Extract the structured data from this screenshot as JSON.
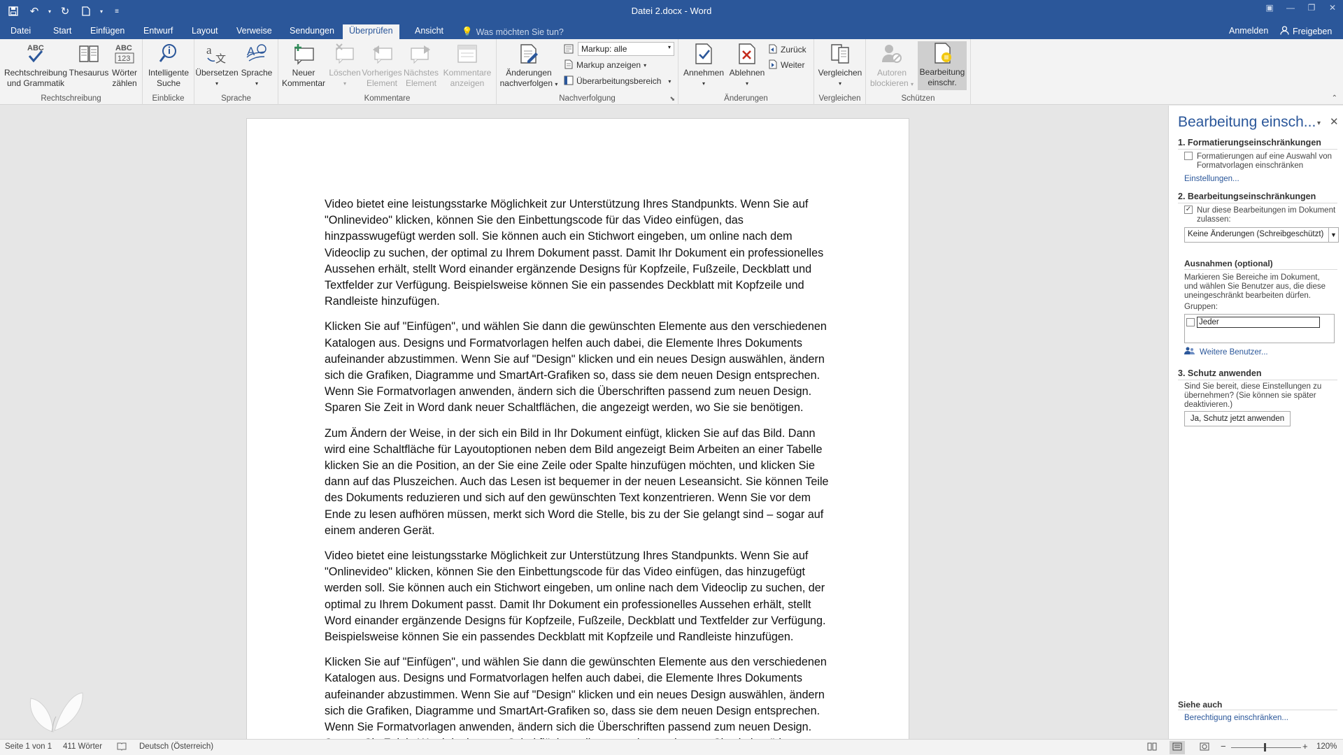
{
  "window": {
    "title": "Datei 2.docx - Word",
    "qat": [
      "save-icon",
      "undo-icon",
      "redo-icon",
      "new-document-icon",
      "customize-qat-icon"
    ],
    "controls": [
      "ribbon-options-icon",
      "minimize-icon",
      "restore-icon",
      "close-icon"
    ]
  },
  "tabs": [
    "Datei",
    "Start",
    "Einfügen",
    "Entwurf",
    "Layout",
    "Verweise",
    "Sendungen",
    "Überprüfen",
    "Ansicht"
  ],
  "active_tab": "Überprüfen",
  "tell_me": "Was möchten Sie tun?",
  "account": {
    "sign_in": "Anmelden",
    "share": "Freigeben"
  },
  "ribbon": {
    "groups": {
      "rechtschreibung": "Rechtschreibung",
      "einblicke": "Einblicke",
      "sprache": "Sprache",
      "kommentare": "Kommentare",
      "nachverfolgung": "Nachverfolgung",
      "aenderungen": "Änderungen",
      "vergleichen": "Vergleichen",
      "schuetzen": "Schützen"
    },
    "buttons": {
      "spelling_1": "Rechtschreibung",
      "spelling_2": "und Grammatik",
      "thesaurus": "Thesaurus",
      "wordcount_1": "Wörter",
      "wordcount_2": "zählen",
      "smart_1": "Intelligente",
      "smart_2": "Suche",
      "translate": "Übersetzen",
      "language": "Sprache",
      "newcomment_1": "Neuer",
      "newcomment_2": "Kommentar",
      "delete": "Löschen",
      "prev_1": "Vorheriges",
      "prev_2": "Element",
      "next_1": "Nächstes",
      "next_2": "Element",
      "show_1": "Kommentare",
      "show_2": "anzeigen",
      "track_1": "Änderungen",
      "track_2": "nachverfolgen",
      "markup_combo": "Markup: alle",
      "show_markup": "Markup anzeigen",
      "review_pane": "Überarbeitungsbereich",
      "accept": "Annehmen",
      "reject": "Ablehnen",
      "previous": "Zurück",
      "next": "Weiter",
      "compare": "Vergleichen",
      "block_1": "Autoren",
      "block_2": "blockieren",
      "restrict_1": "Bearbeitung",
      "restrict_2": "einschr."
    }
  },
  "document": {
    "paragraphs": [
      "Video bietet eine leistungsstarke Möglichkeit zur Unterstützung Ihres Standpunkts. Wenn Sie auf \"Onlinevideo\" klicken, können Sie den Einbettungscode für das Video einfügen, das hinzpasswugefügt werden soll. Sie können auch ein Stichwort eingeben, um online nach dem Videoclip zu suchen, der optimal zu Ihrem Dokument passt. Damit Ihr Dokument ein professionelles Aussehen erhält, stellt Word einander ergänzende Designs für Kopfzeile, Fußzeile, Deckblatt und Textfelder zur Verfügung. Beispielsweise können Sie ein passendes Deckblatt mit Kopfzeile und Randleiste hinzufügen.",
      "Klicken Sie auf \"Einfügen\", und wählen Sie dann die gewünschten Elemente aus den verschiedenen Katalogen aus. Designs und Formatvorlagen helfen auch dabei, die Elemente Ihres Dokuments aufeinander abzustimmen. Wenn Sie auf \"Design\" klicken und ein neues Design auswählen, ändern sich die Grafiken, Diagramme und SmartArt-Grafiken so, dass sie dem neuen Design entsprechen. Wenn Sie Formatvorlagen anwenden, ändern sich die Überschriften passend zum neuen Design. Sparen Sie Zeit in Word dank neuer Schaltflächen, die angezeigt werden, wo Sie sie benötigen.",
      "Zum Ändern der Weise, in der sich ein Bild in Ihr Dokument einfügt, klicken Sie auf das Bild. Dann wird eine Schaltfläche für Layoutoptionen neben dem Bild angezeigt Beim Arbeiten an einer Tabelle klicken Sie an die Position, an der Sie eine Zeile oder Spalte hinzufügen möchten, und klicken Sie dann auf das Pluszeichen. Auch das Lesen ist bequemer in der neuen Leseansicht. Sie können Teile des Dokuments reduzieren und sich auf den gewünschten Text konzentrieren. Wenn Sie vor dem Ende zu lesen aufhören müssen, merkt sich Word die Stelle, bis zu der Sie gelangt sind – sogar auf einem anderen Gerät.",
      "Video bietet eine leistungsstarke Möglichkeit zur Unterstützung Ihres Standpunkts. Wenn Sie auf \"Onlinevideo\" klicken, können Sie den Einbettungscode für das Video einfügen, das hinzugefügt werden soll. Sie können auch ein Stichwort eingeben, um online nach dem Videoclip zu suchen, der optimal zu Ihrem Dokument passt. Damit Ihr Dokument ein professionelles Aussehen erhält, stellt Word einander ergänzende Designs für Kopfzeile, Fußzeile, Deckblatt und Textfelder zur Verfügung. Beispielsweise können Sie ein passendes Deckblatt mit Kopfzeile und Randleiste hinzufügen.",
      "Klicken Sie auf \"Einfügen\", und wählen Sie dann die gewünschten Elemente aus den verschiedenen Katalogen aus. Designs und Formatvorlagen helfen auch dabei, die Elemente Ihres Dokuments aufeinander abzustimmen. Wenn Sie auf \"Design\" klicken und ein neues Design auswählen, ändern sich die Grafiken, Diagramme und SmartArt-Grafiken so, dass sie dem neuen Design entsprechen. Wenn Sie Formatvorlagen anwenden, ändern sich die Überschriften passend zum neuen Design. Sparen Sie Zeit in Word dank neuer Schaltflächen, die angezeigt werden, wo Sie sie benötigen."
    ]
  },
  "pane": {
    "title": "Bearbeitung einsch...",
    "s1_heading": "1. Formatierungseinschränkungen",
    "s1_check_label_1": "Formatierungen auf eine Auswahl von",
    "s1_check_label_2": "Formatvorlagen einschränken",
    "s1_checked": false,
    "s1_link": "Einstellungen...",
    "s2_heading": "2. Bearbeitungseinschränkungen",
    "s2_check_label_1": "Nur diese Bearbeitungen im Dokument",
    "s2_check_label_2": "zulassen:",
    "s2_checked": true,
    "s2_select": "Keine Änderungen (Schreibgeschützt)",
    "exceptions_heading": "Ausnahmen (optional)",
    "exceptions_text_1": "Markieren Sie Bereiche im Dokument,",
    "exceptions_text_2": "und wählen Sie Benutzer aus, die diese",
    "exceptions_text_3": "uneingeschränkt bearbeiten dürfen.",
    "groups_label": "Gruppen:",
    "group_name": "Jeder",
    "more_users": "Weitere Benutzer...",
    "s3_heading": "3. Schutz anwenden",
    "s3_text_1": "Sind Sie bereit, diese Einstellungen zu",
    "s3_text_2": "übernehmen? (Sie können sie später",
    "s3_text_3": "deaktivieren.)",
    "s3_button": "Ja, Schutz jetzt anwenden",
    "see_also": "Siehe auch",
    "see_also_link": "Berechtigung einschränken..."
  },
  "status": {
    "page": "Seite 1 von 1",
    "words": "411 Wörter",
    "language": "Deutsch (Österreich)",
    "zoom": "120%"
  },
  "colors": {
    "accent": "#2b579a",
    "ribbon_bg": "#f3f3f3",
    "reject_red": "#c42b1c"
  }
}
